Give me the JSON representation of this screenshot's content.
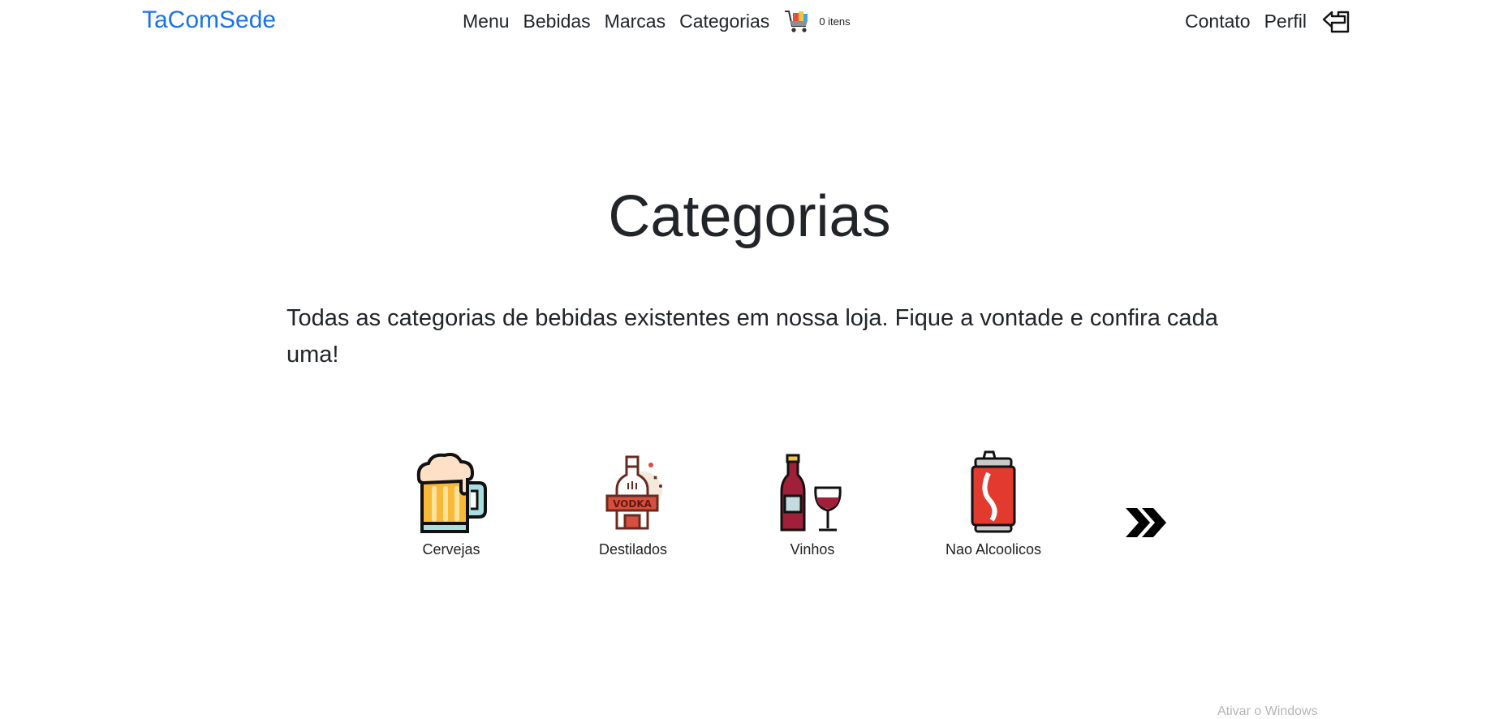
{
  "navbar": {
    "brand": "TaComSede",
    "links": {
      "menu": "Menu",
      "bebidas": "Bebidas",
      "marcas": "Marcas",
      "categorias": "Categorias"
    },
    "cart_count": "0 itens",
    "right_links": {
      "contato": "Contato",
      "perfil": "Perfil"
    },
    "icons": {
      "cart": "shopping-cart-icon",
      "logout": "logout-arrow-icon"
    }
  },
  "main": {
    "title": "Categorias",
    "description": "Todas as categorias de bebidas existentes em nossa loja. Fique a vontade e confira cada uma!"
  },
  "categories": [
    {
      "label": "Cervejas",
      "icon": "beer-mug-icon"
    },
    {
      "label": "Destilados",
      "icon": "vodka-bottle-icon"
    },
    {
      "label": "Vinhos",
      "icon": "wine-bottle-icon"
    },
    {
      "label": "Nao Alcoolicos",
      "icon": "soda-can-icon"
    }
  ],
  "colors": {
    "brand": "#1a73e8",
    "text": "#212529"
  },
  "watermark": "Ativar o Windows"
}
